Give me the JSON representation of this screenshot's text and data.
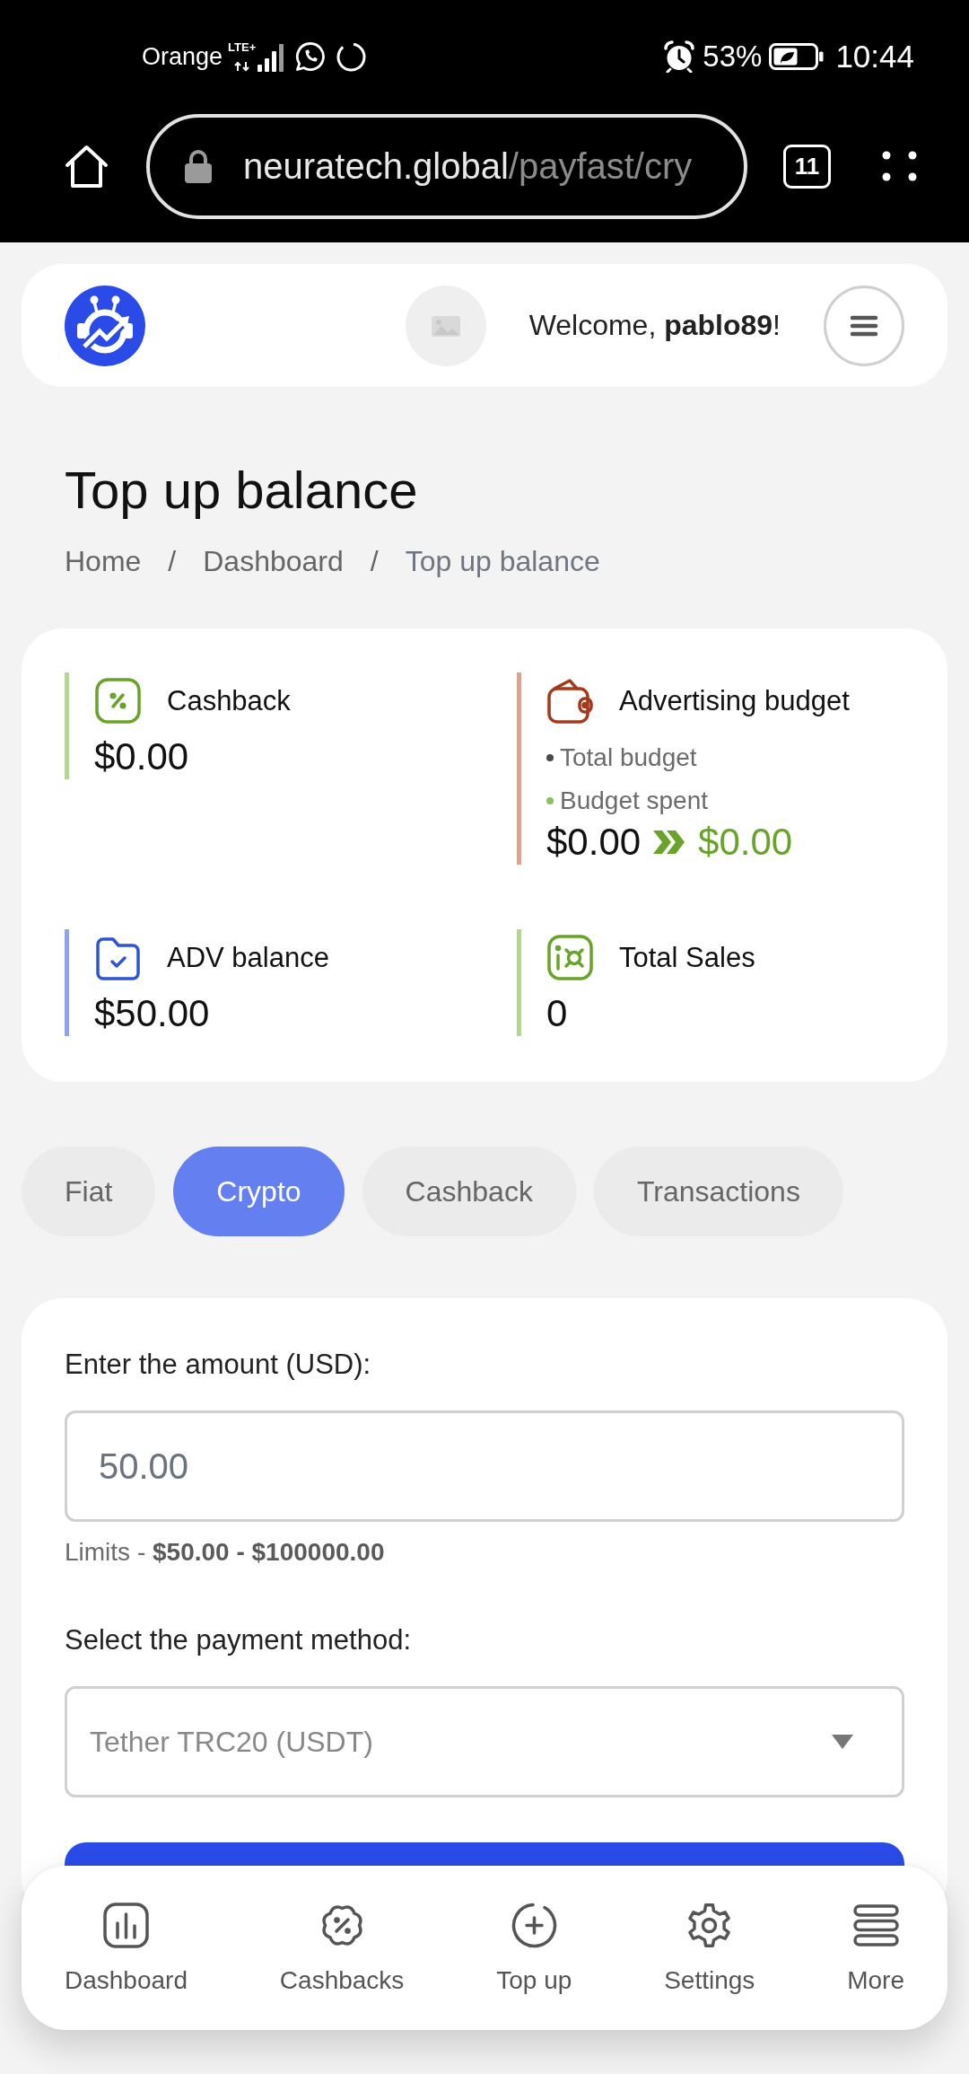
{
  "status_bar": {
    "carrier": "Orange",
    "network": "LTE+",
    "battery": "53%",
    "time": "10:44"
  },
  "browser": {
    "url_host": "neuratech.global",
    "url_path": "/payfast/cry",
    "tab_count": "11"
  },
  "header": {
    "welcome": "Welcome, **pablo89**!"
  },
  "page": {
    "title": "Top up balance",
    "breadcrumb": {
      "separator": "/",
      "items": [
        "Home",
        "Dashboard",
        "Top up balance"
      ]
    }
  },
  "stats": [
    {
      "kind": "value",
      "label": "Cashback",
      "value": "$0.00",
      "color": "#b5d598"
    },
    {
      "kind": "budget",
      "label": "Advertising budget",
      "color": "#d8a592",
      "legend": [
        {
          "label": "Total budget",
          "color": "#4a4a4a"
        },
        {
          "label": "Budget spent",
          "color": "#8cc05c"
        }
      ],
      "values": [
        "$0.00",
        "$0.00"
      ]
    },
    {
      "kind": "value",
      "label": "ADV balance",
      "value": "$50.00",
      "color": "#8fa3ec"
    },
    {
      "kind": "value",
      "label": "Total Sales",
      "value": "0",
      "color": "#b5d598"
    }
  ],
  "tabs": [
    {
      "label": "Fiat",
      "selected": false
    },
    {
      "label": "Crypto",
      "selected": true
    },
    {
      "label": "Cashback",
      "selected": false
    },
    {
      "label": "Transactions",
      "selected": false
    }
  ],
  "form": {
    "amount_label": "Enter the amount (USD):",
    "amount_value": "50.00",
    "limits": "Limits - **$50.00 - $100000.00**",
    "method_label": "Select the payment method:",
    "method_value": "Tether TRC20 (USDT)"
  },
  "bottom_nav": [
    {
      "label": "Dashboard"
    },
    {
      "label": "Cashbacks"
    },
    {
      "label": "Top up"
    },
    {
      "label": "Settings"
    },
    {
      "label": "More"
    }
  ]
}
